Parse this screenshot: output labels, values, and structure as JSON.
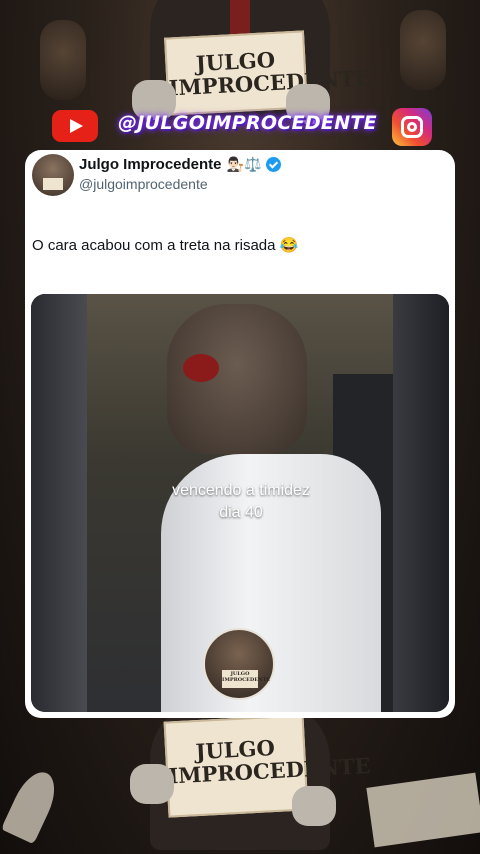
{
  "background": {
    "sign_top": "JULGO IMPROCEDENTE",
    "sign_bottom": "JULGO IMPROCEDENTE"
  },
  "social_bar": {
    "youtube_icon": "youtube-icon",
    "handle": "@JULGOIMPROCEDENTE",
    "instagram_icon": "instagram-icon"
  },
  "tweet": {
    "display_name": "Julgo Improcedente",
    "name_emojis": "👨🏻‍⚖️⚖️",
    "username": "@julgoimprocedente",
    "verified": true,
    "text": "O cara acabou com a treta na risada 😂",
    "video": {
      "caption_line1": "vencendo a timidez",
      "caption_line2": "dia 40",
      "watermark_text": "JULGO IMPROCEDENTE"
    }
  },
  "colors": {
    "card_bg": "#ffffff",
    "verified_blue": "#1d9bf0",
    "youtube_red": "#e62117",
    "handle_glow": "#7a2cff"
  }
}
